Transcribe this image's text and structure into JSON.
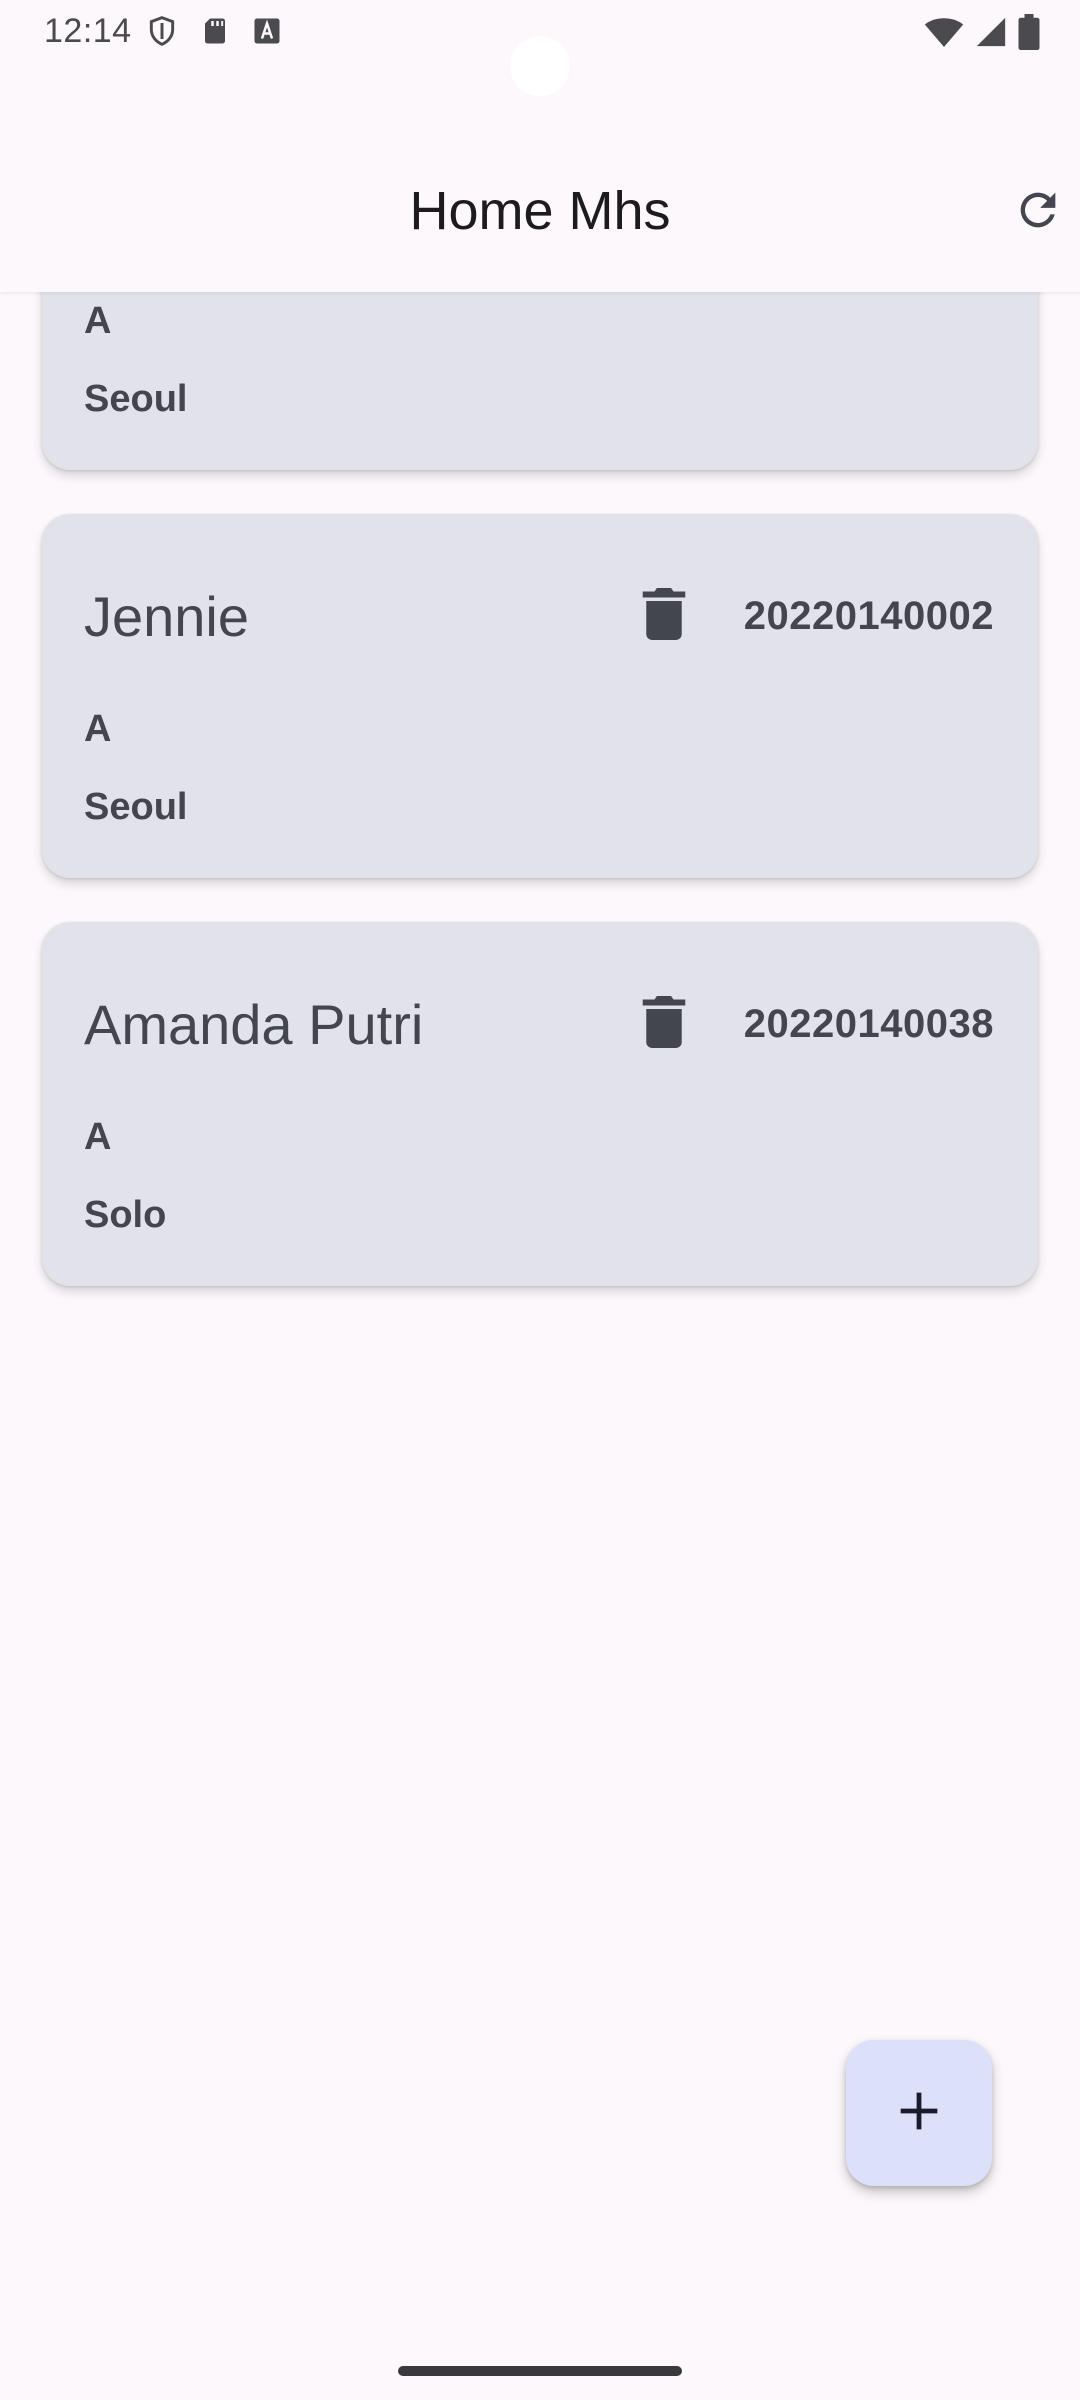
{
  "status_bar": {
    "time": "12:14",
    "left_icons": [
      "shield-icon",
      "sd-card-icon",
      "font-a-icon"
    ],
    "right_icons": [
      "wifi-icon",
      "cellular-signal-icon",
      "battery-icon"
    ]
  },
  "app_bar": {
    "title": "Home Mhs",
    "action_icon": "refresh-icon"
  },
  "students": [
    {
      "name": "",
      "nim": "",
      "class": "A",
      "city": "Seoul"
    },
    {
      "name": "Jennie",
      "nim": "20220140002",
      "class": "A",
      "city": "Seoul"
    },
    {
      "name": "Amanda Putri",
      "nim": "20220140038",
      "class": "A",
      "city": "Solo"
    }
  ],
  "fab": {
    "icon": "plus-icon"
  },
  "colors": {
    "background": "#fcf8fb",
    "card": "#e2e2ea",
    "card_text": "#44464f",
    "fab": "#dce1f9",
    "on_fab": "#1a1c2c"
  }
}
